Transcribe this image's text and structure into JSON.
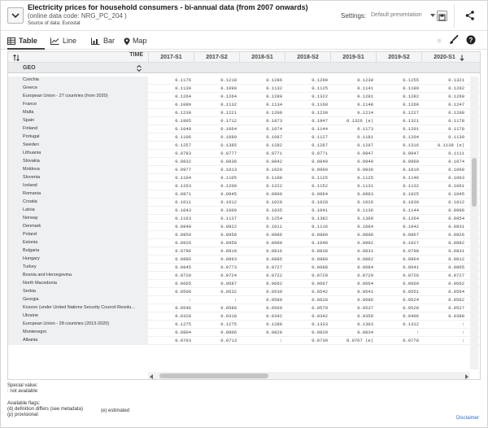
{
  "header": {
    "title": "Electricity prices for household consumers - bi-annual data (from 2007 onwards)",
    "subtitle": "(online data code: NRG_PC_204 )",
    "source": "Source of data: Eurostat",
    "settings_label": "Settings:",
    "preset_value": "Default presentation"
  },
  "tabs": [
    {
      "label": "Table"
    },
    {
      "label": "Line"
    },
    {
      "label": "Bar"
    },
    {
      "label": "Map"
    }
  ],
  "table": {
    "time_label": "TIME",
    "geo_label": "GEO",
    "columns": [
      "2017-S1",
      "2017-S2",
      "2018-S1",
      "2018-S2",
      "2019-S1",
      "2019-S2",
      "2020-S1"
    ],
    "rows": [
      {
        "geo": "Czechia",
        "values": [
          "0.1176",
          "0.1218",
          "0.1286",
          "0.1299",
          "0.1238",
          "0.1255",
          "0.1321"
        ]
      },
      {
        "geo": "Greece",
        "values": [
          "0.1139",
          "0.1090",
          "0.1132",
          "0.1125",
          "0.1141",
          "0.1189",
          "0.1292"
        ]
      },
      {
        "geo": "European Union - 27 countries (from 2020)",
        "values": [
          "0.1264",
          "0.1264",
          "0.1280",
          "0.1322",
          "0.1281",
          "0.1282",
          "0.1269"
        ]
      },
      {
        "geo": "France",
        "values": [
          "0.1089",
          "0.1132",
          "0.1134",
          "0.1168",
          "0.1148",
          "0.1260",
          "0.1247"
        ]
      },
      {
        "geo": "Malta",
        "values": [
          "0.1230",
          "0.1221",
          "0.1209",
          "0.1230",
          "0.1214",
          "0.1227",
          "0.1208"
        ]
      },
      {
        "geo": "Spain",
        "values": [
          "0.1805",
          "0.1712",
          "0.1873",
          "0.1947",
          "0.1326 (e)",
          "0.1321",
          "0.1178"
        ]
      },
      {
        "geo": "Finland",
        "values": [
          "0.1049",
          "0.1064",
          "0.1074",
          "0.1144",
          "0.1173",
          "0.1201",
          "0.1178"
        ]
      },
      {
        "geo": "Portugal",
        "values": [
          "0.1106",
          "0.1080",
          "0.1087",
          "0.1127",
          "0.1181",
          "0.1204",
          "0.1139"
        ]
      },
      {
        "geo": "Sweden",
        "values": [
          "0.1257",
          "0.1385",
          "0.1282",
          "0.1287",
          "0.1297",
          "0.1316",
          "0.1138 (e)"
        ]
      },
      {
        "geo": "Lithuania",
        "values": [
          "0.0783",
          "0.0777",
          "0.0771",
          "0.0771",
          "0.0947",
          "0.0947",
          "0.1111"
        ]
      },
      {
        "geo": "Slovakia",
        "values": [
          "0.0832",
          "0.0838",
          "0.0842",
          "0.0849",
          "0.0949",
          "0.0969",
          "0.1074"
        ]
      },
      {
        "geo": "Moldova",
        "values": [
          "0.0977",
          "0.1013",
          "0.1020",
          "0.0960",
          "0.0936",
          "0.1019",
          "0.1068"
        ]
      },
      {
        "geo": "Slovenia",
        "values": [
          "0.1104",
          "0.1105",
          "0.1108",
          "0.1125",
          "0.1125",
          "0.1146",
          "0.1063"
        ]
      },
      {
        "geo": "Iceland",
        "values": [
          "0.1263",
          "0.1200",
          "0.1222",
          "0.1152",
          "0.1131",
          "0.1132",
          "0.1061"
        ]
      },
      {
        "geo": "Romania",
        "values": [
          "0.0871",
          "0.0945",
          "0.0990",
          "0.0964",
          "0.0983",
          "0.1025",
          "0.1045"
        ]
      },
      {
        "geo": "Croatia",
        "values": [
          "0.1011",
          "0.1012",
          "0.1020",
          "0.1028",
          "0.1026",
          "0.1030",
          "0.1012"
        ]
      },
      {
        "geo": "Latvia",
        "values": [
          "0.1043",
          "0.1009",
          "0.1035",
          "0.1041",
          "0.1136",
          "0.1144",
          "0.0996"
        ]
      },
      {
        "geo": "Norway",
        "values": [
          "0.1163",
          "0.1137",
          "0.1254",
          "0.1382",
          "0.1368",
          "0.1264",
          "0.0954"
        ]
      },
      {
        "geo": "Denmark",
        "values": [
          "0.0940",
          "0.0922",
          "0.1011",
          "0.1116",
          "0.1084",
          "0.1042",
          "0.0931"
        ]
      },
      {
        "geo": "Poland",
        "values": [
          "0.0950",
          "0.0958",
          "0.0986",
          "0.0889",
          "0.0898",
          "0.0867",
          "0.0926"
        ]
      },
      {
        "geo": "Estonia",
        "values": [
          "0.0926",
          "0.0950",
          "0.0989",
          "0.1048",
          "0.0992",
          "0.1027",
          "0.0882"
        ]
      },
      {
        "geo": "Bulgaria",
        "values": [
          "0.0796",
          "0.0819",
          "0.0816",
          "0.0830",
          "0.0831",
          "0.0798",
          "0.0831"
        ]
      },
      {
        "geo": "Hungary",
        "values": [
          "0.0886",
          "0.0893",
          "0.0885",
          "0.0880",
          "0.0882",
          "0.0864",
          "0.0812"
        ]
      },
      {
        "geo": "Turkey",
        "values": [
          "0.0845",
          "0.0773",
          "0.0727",
          "0.0688",
          "0.0684",
          "0.0641",
          "0.0805"
        ]
      },
      {
        "geo": "Bosnia and Herzegovina",
        "values": [
          "0.0720",
          "0.0724",
          "0.0722",
          "0.0729",
          "0.0729",
          "0.0726",
          "0.0727"
        ]
      },
      {
        "geo": "North Macedonia",
        "values": [
          "0.0665",
          "0.0687",
          "0.0662",
          "0.0667",
          "0.0664",
          "0.0669",
          "0.0662"
        ]
      },
      {
        "geo": "Serbia",
        "values": [
          "0.0508",
          "0.0532",
          "0.0539",
          "0.0542",
          "0.0541",
          "0.0551",
          "0.0564"
        ]
      },
      {
        "geo": "Georgia",
        "values": [
          ":",
          ":",
          "0.0580",
          "0.0628",
          "0.0686",
          "0.0524",
          "0.0562"
        ]
      },
      {
        "geo": "Kosovo (under United Nations Security Council Resolu...",
        "values": [
          "0.0546",
          "0.0588",
          "0.0569",
          "0.0579",
          "0.0537",
          "0.0528",
          "0.0527"
        ]
      },
      {
        "geo": "Ukraine",
        "values": [
          "0.0328",
          "0.0318",
          "0.0342",
          "0.0342",
          "0.0359",
          "0.0406",
          "0.0388"
        ]
      },
      {
        "geo": "European Union - 28 countries (2013-2020)",
        "values": [
          "0.1275",
          "0.1275",
          "0.1288",
          "0.1333",
          "0.1303",
          "0.1312",
          ":"
        ]
      },
      {
        "geo": "Montenegro",
        "values": [
          "0.0804",
          "0.0806",
          "0.0828",
          "0.0829",
          "0.0834",
          ":",
          ":"
        ]
      },
      {
        "geo": "Albania",
        "values": [
          "0.0703",
          "0.0713",
          ":",
          "0.0739",
          "0.0767 (e)",
          "0.0778",
          ":"
        ]
      }
    ]
  },
  "footer": {
    "special_value_label": "Special value:",
    "special_value_1": ": not available",
    "flags_label": "Available flags:",
    "flag_d": "(d) definition differs (see metadata)",
    "flag_e": "(e) estimated",
    "flag_p": "(p) provisional",
    "disclaimer": "Disclaimer"
  },
  "colors": {
    "accent": "#2d6cc0",
    "geo_bg": "#eef0f2",
    "header_bg": "#e9ebed"
  }
}
